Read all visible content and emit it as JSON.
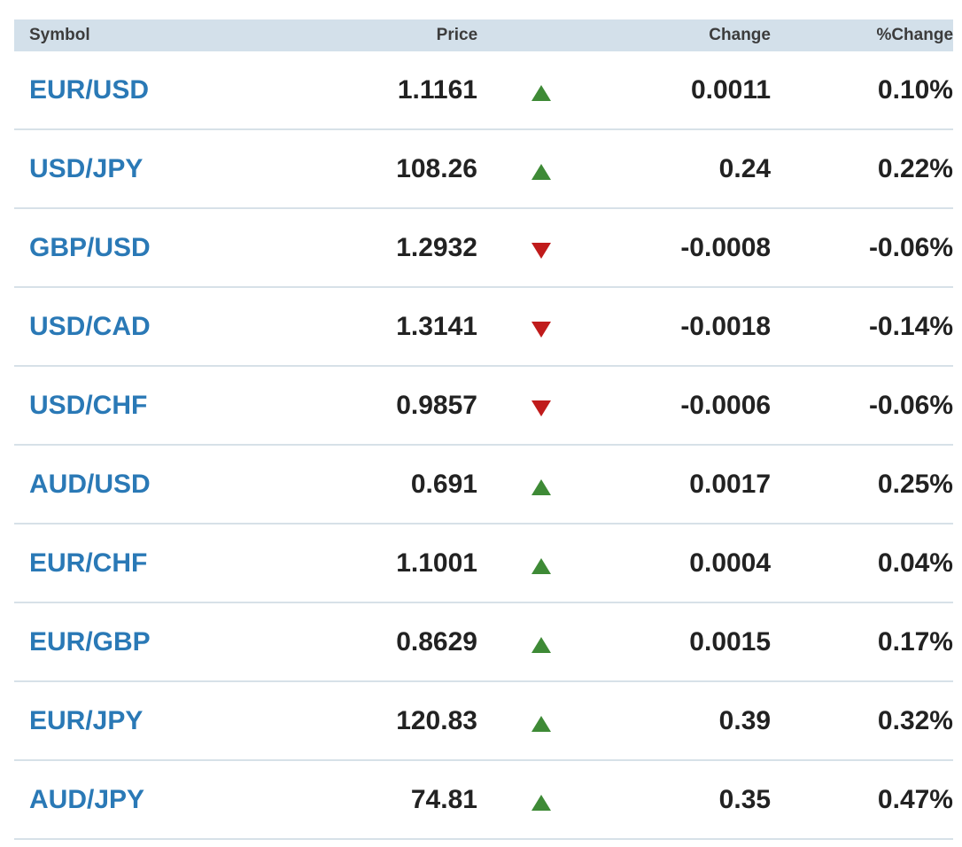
{
  "header": {
    "symbol": "Symbol",
    "price": "Price",
    "change": "Change",
    "pct_change": "%Change"
  },
  "colors": {
    "link": "#2a79b6",
    "up": "#3e8a36",
    "down": "#c01b1b",
    "header_bg": "#d3e0ea"
  },
  "rows": [
    {
      "symbol": "EUR/USD",
      "price": "1.1161",
      "direction": "up",
      "change": "0.0011",
      "pct": "0.10%"
    },
    {
      "symbol": "USD/JPY",
      "price": "108.26",
      "direction": "up",
      "change": "0.24",
      "pct": "0.22%"
    },
    {
      "symbol": "GBP/USD",
      "price": "1.2932",
      "direction": "down",
      "change": "-0.0008",
      "pct": "-0.06%"
    },
    {
      "symbol": "USD/CAD",
      "price": "1.3141",
      "direction": "down",
      "change": "-0.0018",
      "pct": "-0.14%"
    },
    {
      "symbol": "USD/CHF",
      "price": "0.9857",
      "direction": "down",
      "change": "-0.0006",
      "pct": "-0.06%"
    },
    {
      "symbol": "AUD/USD",
      "price": "0.691",
      "direction": "up",
      "change": "0.0017",
      "pct": "0.25%"
    },
    {
      "symbol": "EUR/CHF",
      "price": "1.1001",
      "direction": "up",
      "change": "0.0004",
      "pct": "0.04%"
    },
    {
      "symbol": "EUR/GBP",
      "price": "0.8629",
      "direction": "up",
      "change": "0.0015",
      "pct": "0.17%"
    },
    {
      "symbol": "EUR/JPY",
      "price": "120.83",
      "direction": "up",
      "change": "0.39",
      "pct": "0.32%"
    },
    {
      "symbol": "AUD/JPY",
      "price": "74.81",
      "direction": "up",
      "change": "0.35",
      "pct": "0.47%"
    }
  ]
}
